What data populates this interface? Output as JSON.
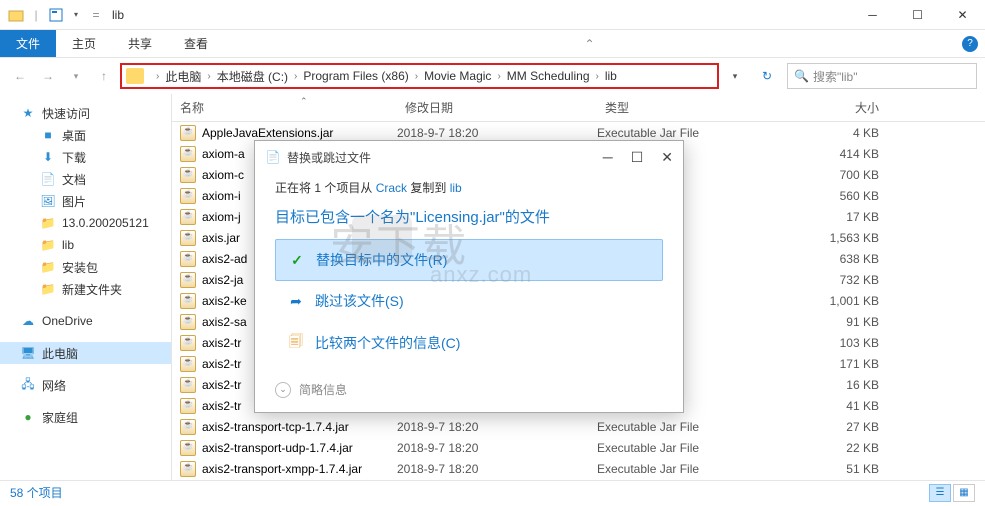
{
  "window": {
    "title": "lib"
  },
  "tabs": {
    "file": "文件",
    "home": "主页",
    "share": "共享",
    "view": "查看"
  },
  "breadcrumb": {
    "root": "此电脑",
    "segs": [
      "本地磁盘 (C:)",
      "Program Files (x86)",
      "Movie Magic",
      "MM Scheduling",
      "lib"
    ]
  },
  "search": {
    "placeholder": "搜索\"lib\""
  },
  "columns": {
    "name": "名称",
    "date": "修改日期",
    "type": "类型",
    "size": "大小"
  },
  "sidebar": {
    "quick": "快速访问",
    "desktop": "桌面",
    "downloads": "下载",
    "documents": "文档",
    "pictures": "图片",
    "folder1": "13.0.200205121",
    "folder2": "lib",
    "folder3": "安装包",
    "folder4": "新建文件夹",
    "onedrive": "OneDrive",
    "thispc": "此电脑",
    "network": "网络",
    "homegroup": "家庭组"
  },
  "files": [
    {
      "name": "AppleJavaExtensions.jar",
      "date": "2018-9-7 18:20",
      "type": "Executable Jar File",
      "size": "4 KB"
    },
    {
      "name": "axiom-a",
      "date": "",
      "type": "",
      "size": "414 KB"
    },
    {
      "name": "axiom-c",
      "date": "",
      "type": "",
      "size": "700 KB"
    },
    {
      "name": "axiom-i",
      "date": "",
      "type": "",
      "size": "560 KB"
    },
    {
      "name": "axiom-j",
      "date": "",
      "type": "",
      "size": "17 KB"
    },
    {
      "name": "axis.jar",
      "date": "",
      "type": "",
      "size": "1,563 KB"
    },
    {
      "name": "axis2-ad",
      "date": "",
      "type": "",
      "size": "638 KB"
    },
    {
      "name": "axis2-ja",
      "date": "",
      "type": "",
      "size": "732 KB"
    },
    {
      "name": "axis2-ke",
      "date": "",
      "type": "",
      "size": "1,001 KB"
    },
    {
      "name": "axis2-sa",
      "date": "",
      "type": "",
      "size": "91 KB"
    },
    {
      "name": "axis2-tr",
      "date": "",
      "type": "",
      "size": "103 KB"
    },
    {
      "name": "axis2-tr",
      "date": "",
      "type": "",
      "size": "171 KB"
    },
    {
      "name": "axis2-tr",
      "date": "",
      "type": "",
      "size": "16 KB"
    },
    {
      "name": "axis2-tr",
      "date": "",
      "type": "",
      "size": "41 KB"
    },
    {
      "name": "axis2-transport-tcp-1.7.4.jar",
      "date": "2018-9-7 18:20",
      "type": "Executable Jar File",
      "size": "27 KB"
    },
    {
      "name": "axis2-transport-udp-1.7.4.jar",
      "date": "2018-9-7 18:20",
      "type": "Executable Jar File",
      "size": "22 KB"
    },
    {
      "name": "axis2-transport-xmpp-1.7.4.jar",
      "date": "2018-9-7 18:20",
      "type": "Executable Jar File",
      "size": "51 KB"
    }
  ],
  "status": {
    "count": "58 个项目"
  },
  "dialog": {
    "title": "替换或跳过文件",
    "line1a": "正在将 1 个项目从 ",
    "line1_src": "Crack",
    "line1b": " 复制到 ",
    "line1_dst": "lib",
    "line2": "目标已包含一个名为\"Licensing.jar\"的文件",
    "opt_replace": "替换目标中的文件(R)",
    "opt_skip": "跳过该文件(S)",
    "opt_compare": "比较两个文件的信息(C)",
    "expand": "简略信息"
  }
}
